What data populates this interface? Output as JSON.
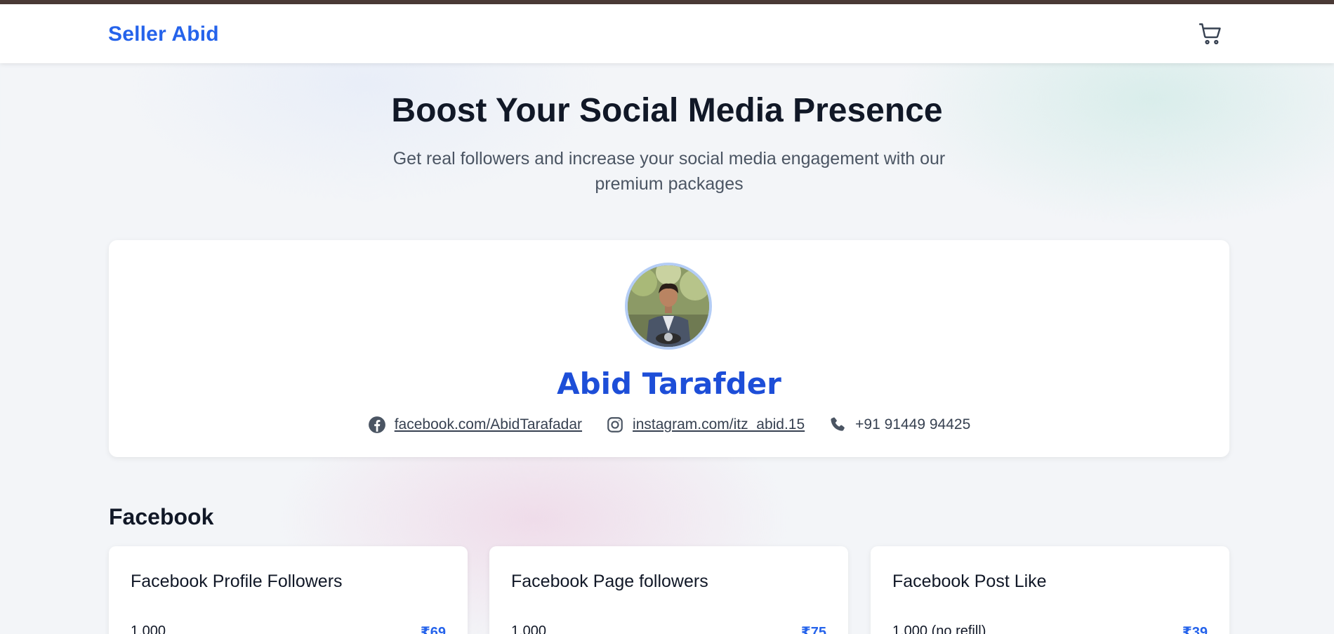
{
  "navbar": {
    "brand": "Seller Abid",
    "cart_icon": "shopping-cart-icon"
  },
  "hero": {
    "title": "Boost Your Social Media Presence",
    "subtitle": "Get real followers and increase your social media engagement with our premium packages"
  },
  "profile": {
    "name": "Abid Tarafder",
    "avatar_icon": "profile-photo",
    "contacts": [
      {
        "icon": "facebook-icon",
        "text": "facebook.com/AbidTarafadar"
      },
      {
        "icon": "instagram-icon",
        "text": "instagram.com/itz_abid.15"
      },
      {
        "icon": "phone-icon",
        "text": "+91 91449 94425"
      }
    ]
  },
  "sections": [
    {
      "title": "Facebook",
      "packages": [
        {
          "title": "Facebook Profile Followers",
          "first_option": {
            "qty": "1,000",
            "price": "₹69"
          }
        },
        {
          "title": "Facebook Page followers",
          "first_option": {
            "qty": "1,000",
            "price": "₹75"
          }
        },
        {
          "title": "Facebook Post Like",
          "first_option": {
            "qty": "1,000 (no refill)",
            "price": "₹39"
          }
        }
      ]
    }
  ],
  "colors": {
    "brand": "#2563eb",
    "name": "#1d4ed8",
    "price": "#2563eb",
    "top_strip": "#4a3a36"
  }
}
